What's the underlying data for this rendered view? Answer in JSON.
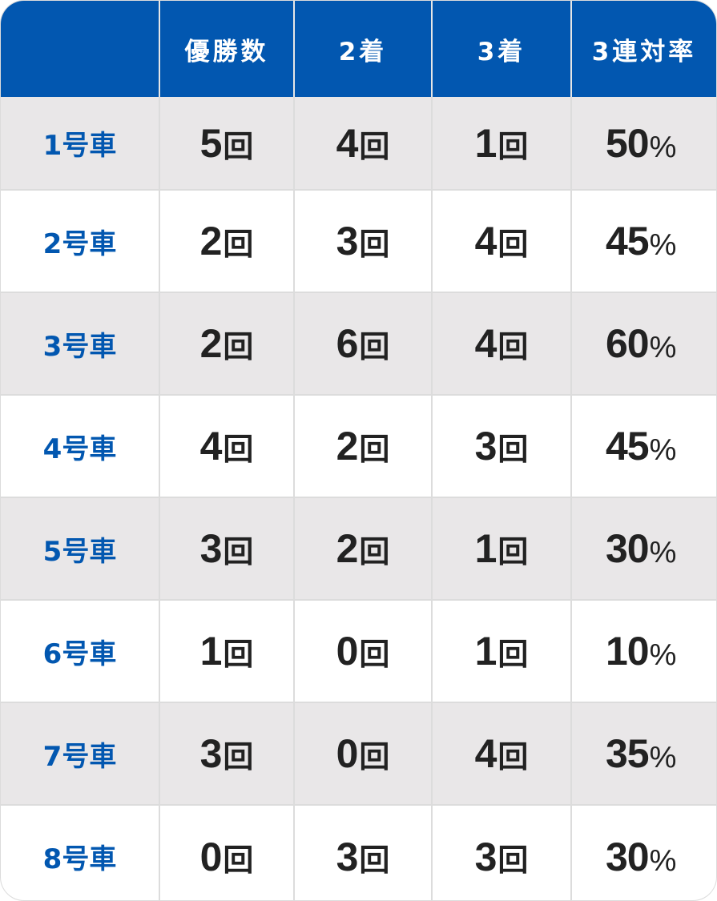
{
  "table": {
    "headers": [
      "",
      "優勝数",
      "2着",
      "3着",
      "3連対率"
    ],
    "count_unit": "回",
    "percent_unit": "%",
    "rows": [
      {
        "car": "1号車",
        "wins": "5",
        "second": "4",
        "third": "1",
        "rate": "50"
      },
      {
        "car": "2号車",
        "wins": "2",
        "second": "3",
        "third": "4",
        "rate": "45"
      },
      {
        "car": "3号車",
        "wins": "2",
        "second": "6",
        "third": "4",
        "rate": "60"
      },
      {
        "car": "4号車",
        "wins": "4",
        "second": "2",
        "third": "3",
        "rate": "45"
      },
      {
        "car": "5号車",
        "wins": "3",
        "second": "2",
        "third": "1",
        "rate": "30"
      },
      {
        "car": "6号車",
        "wins": "1",
        "second": "0",
        "third": "1",
        "rate": "10"
      },
      {
        "car": "7号車",
        "wins": "3",
        "second": "0",
        "third": "4",
        "rate": "35"
      },
      {
        "car": "8号車",
        "wins": "0",
        "second": "3",
        "third": "3",
        "rate": "30"
      }
    ]
  },
  "colors": {
    "header_bg": "#0257b0",
    "header_text": "#ffffff",
    "car_label": "#0257b0",
    "value_text": "#222222",
    "row_stripe": "#e9e7e8",
    "row_plain": "#ffffff",
    "grid_line": "#dcdcdc"
  }
}
